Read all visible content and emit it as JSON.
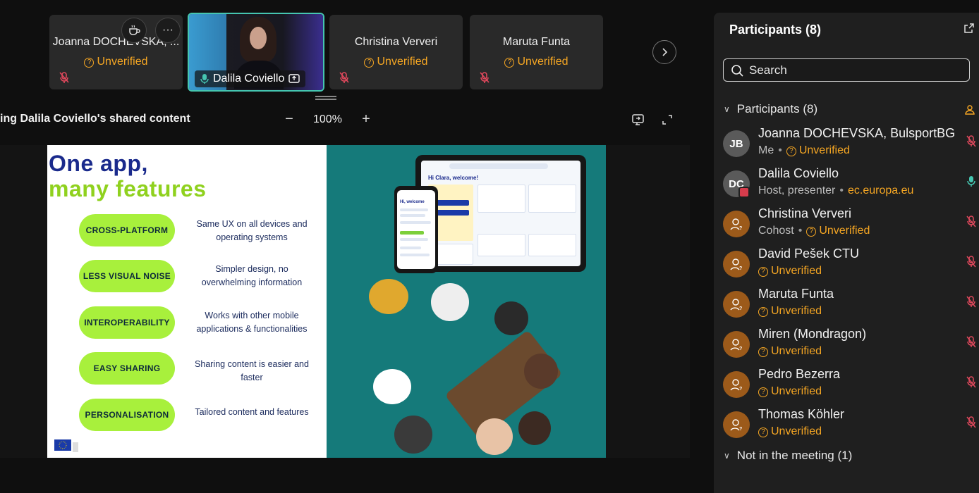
{
  "strip": {
    "tiles": [
      {
        "name": "Joanna DOCHEVSKA, ...",
        "status": "Unverified"
      },
      {
        "name": "Dalila Coviello",
        "status": ""
      },
      {
        "name": "Christina Ververi",
        "status": "Unverified"
      },
      {
        "name": "Maruta Funta",
        "status": "Unverified"
      }
    ],
    "more_label": "···"
  },
  "share": {
    "title": "ing Dalila Coviello's shared content",
    "zoom": "100%",
    "zoom_out": "−",
    "zoom_in": "+"
  },
  "slide": {
    "title_line1": "One app,",
    "title_line2": "many features",
    "features": [
      {
        "label": "CROSS-PLATFORM",
        "desc": "Same UX on all devices and operating systems"
      },
      {
        "label": "LESS VISUAL NOISE",
        "desc": "Simpler design, no overwhelming information"
      },
      {
        "label": "INTEROPERABILITY",
        "desc": "Works with other mobile applications & functionalities"
      },
      {
        "label": "EASY SHARING",
        "desc": "Sharing content is easier and faster"
      },
      {
        "label": "PERSONALISATION",
        "desc": "Tailored content and features"
      }
    ],
    "tablet_greeting": "Hi Clara, welcome!",
    "phone_greeting": "Hi, welcome"
  },
  "panel": {
    "title": "Participants (8)",
    "search_placeholder": "Search",
    "section_participants": "Participants (8)",
    "section_not_in_meeting": "Not in the meeting (1)",
    "participants": [
      {
        "name": "Joanna DOCHEVSKA, BulsportBG",
        "role": "Me",
        "status": "Unverified",
        "initials": "JB"
      },
      {
        "name": "Dalila Coviello",
        "role": "Host, presenter",
        "status": "ec.europa.eu",
        "initials": "DC"
      },
      {
        "name": "Christina Ververi",
        "role": "Cohost",
        "status": "Unverified"
      },
      {
        "name": "David Pešek CTU",
        "role": "",
        "status": "Unverified"
      },
      {
        "name": "Maruta Funta",
        "role": "",
        "status": "Unverified"
      },
      {
        "name": "Miren (Mondragon)",
        "role": "",
        "status": "Unverified"
      },
      {
        "name": "Pedro Bezerra",
        "role": "",
        "status": "Unverified"
      },
      {
        "name": "Thomas Köhler",
        "role": "",
        "status": "Unverified"
      }
    ]
  },
  "colors": {
    "accent_teal": "#45c5b0",
    "unverified_orange": "#f5a623",
    "muted_red": "#e0485c",
    "slide_green": "#a8f03c",
    "slide_navy": "#1a2a8c"
  }
}
